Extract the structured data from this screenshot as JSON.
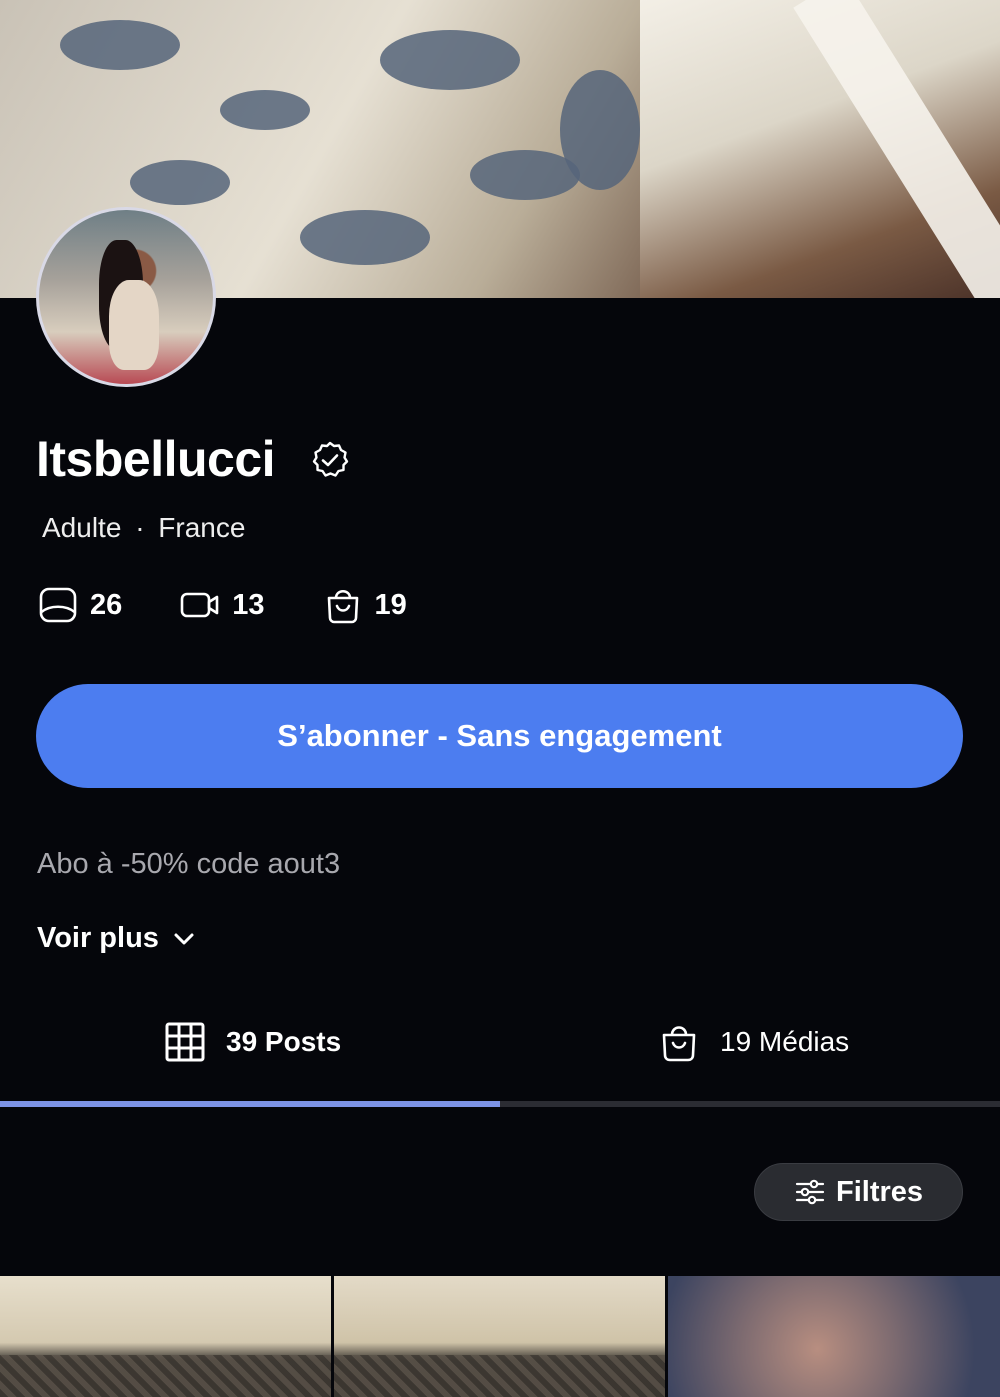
{
  "profile": {
    "username": "Itsbellucci",
    "category": "Adulte",
    "separator": "·",
    "country": "France",
    "verified": true
  },
  "stats": [
    {
      "icon": "image-icon",
      "value": "26"
    },
    {
      "icon": "video-icon",
      "value": "13"
    },
    {
      "icon": "shopping-bag-icon",
      "value": "19"
    }
  ],
  "subscribe_label": "S’abonner - Sans engagement",
  "promo_text": "Abo à -50% code aout3",
  "see_more_label": "Voir plus",
  "tabs": [
    {
      "icon": "grid-icon",
      "label": "39 Posts",
      "active": true
    },
    {
      "icon": "shopping-bag-icon",
      "label": "19 Médias",
      "active": false
    }
  ],
  "filters_label": "Filtres",
  "colors": {
    "background": "#05060b",
    "accent": "#4c7df0",
    "tab_indicator": "#7d93e6",
    "muted_text": "#a8a8ae"
  }
}
